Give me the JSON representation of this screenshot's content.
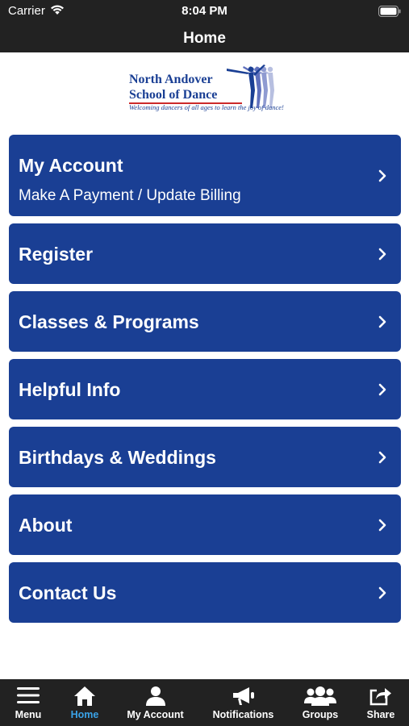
{
  "status_bar": {
    "carrier": "Carrier",
    "time": "8:04 PM"
  },
  "nav": {
    "title": "Home"
  },
  "logo": {
    "line1": "North Andover",
    "line2": "School of Dance",
    "tagline": "Welcoming dancers of all ages to learn the joy of dance!"
  },
  "menu": {
    "items": [
      {
        "label": "My Account",
        "sublabel": "Make A Payment / Update Billing"
      },
      {
        "label": "Register"
      },
      {
        "label": "Classes & Programs"
      },
      {
        "label": "Helpful Info"
      },
      {
        "label": "Birthdays & Weddings"
      },
      {
        "label": "About"
      },
      {
        "label": "Contact Us"
      }
    ]
  },
  "tabs": [
    {
      "label": "Menu",
      "icon": "hamburger-icon"
    },
    {
      "label": "Home",
      "icon": "home-icon",
      "active": true
    },
    {
      "label": "My Account",
      "icon": "user-icon"
    },
    {
      "label": "Notifications",
      "icon": "megaphone-icon"
    },
    {
      "label": "Groups",
      "icon": "group-icon"
    },
    {
      "label": "Share",
      "icon": "share-icon"
    }
  ],
  "colors": {
    "bar_background": "#222222",
    "menu_blue": "#1a3f94",
    "active_tab": "#3aa3e8",
    "logo_red": "#cc2a2a"
  }
}
